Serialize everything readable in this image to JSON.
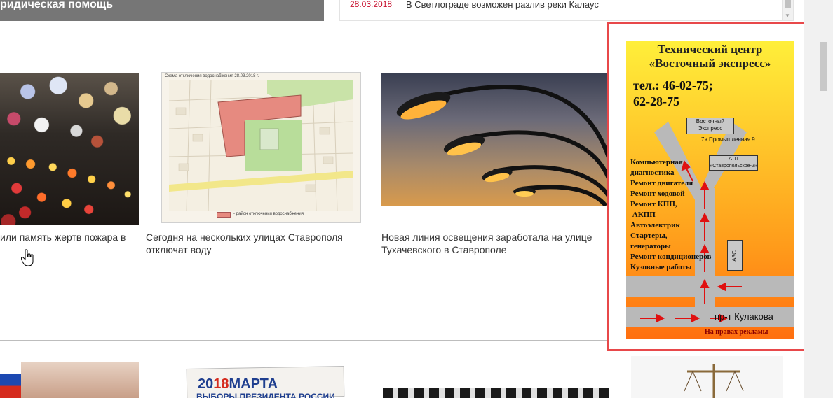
{
  "legal_banner": {
    "text": "ридическая помощь"
  },
  "ticker": {
    "date": "28.03.2018",
    "text": "В Светлограде возможен разлив реки Калаус"
  },
  "news_row_1": [
    {
      "caption": "или память жертв пожара в"
    },
    {
      "caption": "Сегодня на нескольких улицах Ставрополя отключат воду"
    },
    {
      "caption": "Новая линия освещения заработала на улице Тухачевского в Ставрополе"
    }
  ],
  "map_image": {
    "title": "Схема отключения водоснабжения 28.03.2018 г.",
    "legend": "- район отключения водоснабжения"
  },
  "ad": {
    "title_line1": "Технический центр",
    "title_line2": "«Восточный экспресс»",
    "phone_line1": "тел.: 46-02-75;",
    "phone_line2": "62-28-75",
    "box_vostochny_1": "Восточный",
    "box_vostochny_2": "Экспресс",
    "address": "7я Промышленная 9",
    "box_atp_1": "АТП",
    "box_atp_2": "«Ставропольское-2»",
    "box_azs": "АЗС",
    "services": [
      "Компьютерная",
      "диагностика",
      "Ремонт двигателя",
      "Ремонт ходовой",
      "Ремонт КПП,",
      " АКПП",
      "Автоэлектрик",
      "Стартеры,",
      "генераторы",
      "Ремонт кондиционеров",
      "Кузовные работы"
    ],
    "road": "пр-т Кулакова",
    "notice": "На правах рекламы"
  },
  "elections_image": {
    "date_prefix": "20",
    "date_hl": "18",
    "date_rest": "МАРТА",
    "sub": "ВЫБОРЫ ПРЕЗИДЕНТА РОССИИ"
  },
  "colors": {
    "accent_red": "#c8102e",
    "ad_border": "#e8484a",
    "banner_grey": "#767676"
  }
}
